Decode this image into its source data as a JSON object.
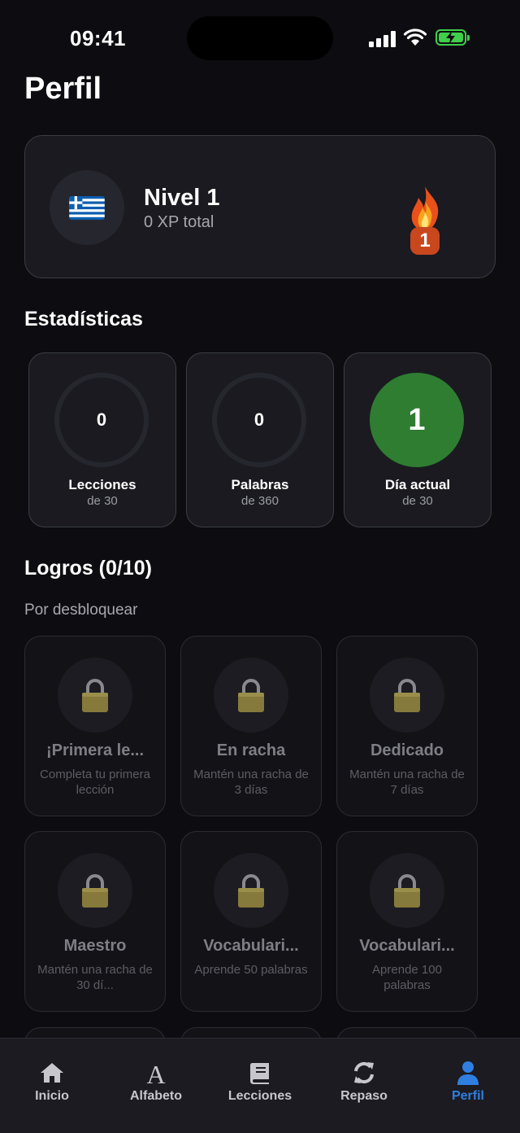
{
  "status_bar": {
    "time": "09:41"
  },
  "page_title": "Perfil",
  "profile": {
    "flag": "greece-flag",
    "level": "Nivel 1",
    "xp": "0 XP total",
    "streak_icon": "fire-icon",
    "streak_count": "1"
  },
  "stats": {
    "title": "Estadísticas",
    "items": [
      {
        "value": "0",
        "label": "Lecciones",
        "sub": "de 30"
      },
      {
        "value": "0",
        "label": "Palabras",
        "sub": "de 360"
      },
      {
        "value": "1",
        "label": "Día actual",
        "sub": "de 30"
      }
    ]
  },
  "achievements": {
    "title": "Logros (0/10)",
    "subtitle": "Por desbloquear",
    "items": [
      {
        "title": "¡Primera le...",
        "desc": "Completa tu primera lección"
      },
      {
        "title": "En racha",
        "desc": "Mantén una racha de 3 días"
      },
      {
        "title": "Dedicado",
        "desc": "Mantén una racha de 7 días"
      },
      {
        "title": "Maestro",
        "desc": "Mantén una racha de 30 dí..."
      },
      {
        "title": "Vocabulari...",
        "desc": "Aprende 50 palabras"
      },
      {
        "title": "Vocabulari...",
        "desc": "Aprende 100 palabras"
      }
    ]
  },
  "tabs": [
    {
      "label": "Inicio",
      "icon": "home-icon"
    },
    {
      "label": "Alfabeto",
      "icon": "alphabet-icon"
    },
    {
      "label": "Lecciones",
      "icon": "book-icon"
    },
    {
      "label": "Repaso",
      "icon": "refresh-icon"
    },
    {
      "label": "Perfil",
      "icon": "user-icon",
      "active": true
    }
  ],
  "colors": {
    "accent": "#2f7fe0",
    "success": "#2f7d31",
    "streak": "#c8471d"
  }
}
